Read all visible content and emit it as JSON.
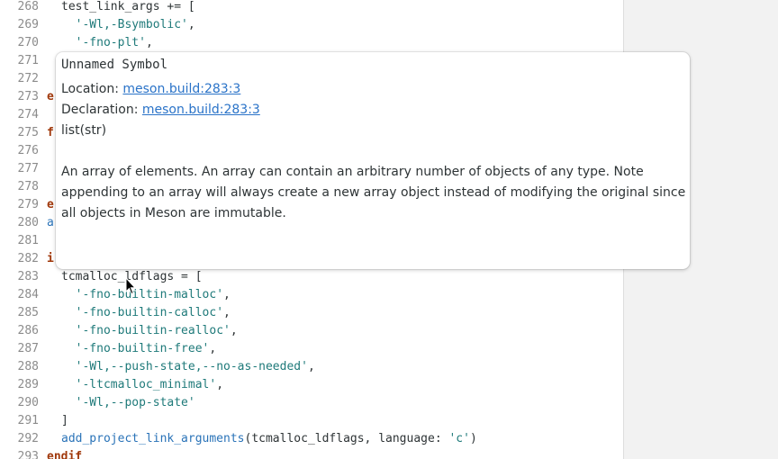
{
  "editor": {
    "lines": [
      {
        "num": "268",
        "indent": 0,
        "tokens": [
          {
            "t": "test_link_args += [",
            "c": "plain"
          }
        ]
      },
      {
        "num": "269",
        "indent": 2,
        "tokens": [
          {
            "t": "'-Wl,-Bsymbolic'",
            "c": "str"
          },
          {
            "t": ",",
            "c": "plain"
          }
        ]
      },
      {
        "num": "270",
        "indent": 2,
        "tokens": [
          {
            "t": "'-fno-plt'",
            "c": "str"
          },
          {
            "t": ",",
            "c": "plain"
          }
        ]
      },
      {
        "num": "271",
        "indent": 0,
        "tokens": []
      },
      {
        "num": "272",
        "indent": 0,
        "tokens": []
      },
      {
        "num": "273",
        "indent": -1,
        "tokens": [
          {
            "t": "e",
            "c": "kw"
          }
        ]
      },
      {
        "num": "274",
        "indent": 0,
        "tokens": []
      },
      {
        "num": "275",
        "indent": -1,
        "tokens": [
          {
            "t": "f",
            "c": "kw"
          }
        ]
      },
      {
        "num": "276",
        "indent": 0,
        "tokens": []
      },
      {
        "num": "277",
        "indent": 0,
        "tokens": []
      },
      {
        "num": "278",
        "indent": 0,
        "tokens": []
      },
      {
        "num": "279",
        "indent": -1,
        "tokens": [
          {
            "t": "e",
            "c": "kw"
          }
        ]
      },
      {
        "num": "280",
        "indent": -1,
        "tokens": [
          {
            "t": "a",
            "c": "fn"
          }
        ]
      },
      {
        "num": "281",
        "indent": 0,
        "tokens": []
      },
      {
        "num": "282",
        "indent": -1,
        "tokens": [
          {
            "t": "i",
            "c": "kw"
          }
        ]
      },
      {
        "num": "283",
        "indent": 0,
        "tokens": [
          {
            "t": "tcmalloc_ldflags = [",
            "c": "plain"
          }
        ]
      },
      {
        "num": "284",
        "indent": 2,
        "tokens": [
          {
            "t": "'-fno-builtin-malloc'",
            "c": "str"
          },
          {
            "t": ",",
            "c": "plain"
          }
        ]
      },
      {
        "num": "285",
        "indent": 2,
        "tokens": [
          {
            "t": "'-fno-builtin-calloc'",
            "c": "str"
          },
          {
            "t": ",",
            "c": "plain"
          }
        ]
      },
      {
        "num": "286",
        "indent": 2,
        "tokens": [
          {
            "t": "'-fno-builtin-realloc'",
            "c": "str"
          },
          {
            "t": ",",
            "c": "plain"
          }
        ]
      },
      {
        "num": "287",
        "indent": 2,
        "tokens": [
          {
            "t": "'-fno-builtin-free'",
            "c": "str"
          },
          {
            "t": ",",
            "c": "plain"
          }
        ]
      },
      {
        "num": "288",
        "indent": 2,
        "tokens": [
          {
            "t": "'-Wl,--push-state,--no-as-needed'",
            "c": "str"
          },
          {
            "t": ",",
            "c": "plain"
          }
        ]
      },
      {
        "num": "289",
        "indent": 2,
        "tokens": [
          {
            "t": "'-ltcmalloc_minimal'",
            "c": "str"
          },
          {
            "t": ",",
            "c": "plain"
          }
        ]
      },
      {
        "num": "290",
        "indent": 2,
        "tokens": [
          {
            "t": "'-Wl,--pop-state'",
            "c": "str"
          }
        ]
      },
      {
        "num": "291",
        "indent": 0,
        "tokens": [
          {
            "t": "]",
            "c": "plain"
          }
        ]
      },
      {
        "num": "292",
        "indent": 0,
        "tokens": [
          {
            "t": "add_project_link_arguments",
            "c": "fn"
          },
          {
            "t": "(tcmalloc_ldflags, language: ",
            "c": "plain"
          },
          {
            "t": "'c'",
            "c": "str"
          },
          {
            "t": ")",
            "c": "plain"
          }
        ]
      },
      {
        "num": "293",
        "indent": -1,
        "tokens": [
          {
            "t": "endif",
            "c": "kw"
          }
        ]
      }
    ]
  },
  "tooltip": {
    "title": "Unnamed Symbol",
    "location_label": "Location: ",
    "location_link": "meson.build:283:3",
    "declaration_label": "Declaration: ",
    "declaration_link": "meson.build:283:3",
    "type": "list(str)",
    "description": "An array of elements. An array can contain an arbitrary number of objects of any type. Note appending to an array will always create a new array object instead of modifying the original since all objects in Meson are immutable."
  },
  "icons": {
    "cursor": "mouse-pointer-icon"
  },
  "colors": {
    "string": "#1f7a7a",
    "keyword": "#a0380b",
    "function": "#2a73b8",
    "link": "#2a73c8",
    "line_number": "#8c8c8c"
  }
}
